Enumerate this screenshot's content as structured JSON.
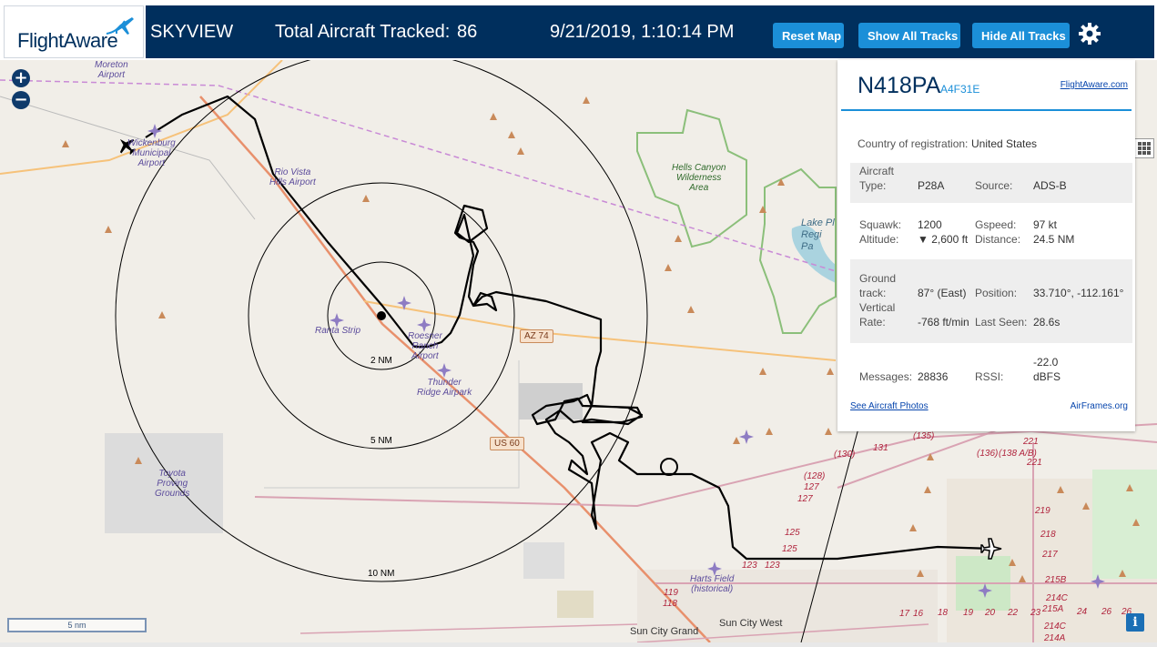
{
  "header": {
    "logo_text": "FlightAware",
    "app_title": "SKYVIEW",
    "total_label": "Total Aircraft Tracked:",
    "total_count": "86",
    "datetime": "9/21/2019, 1:10:14 PM",
    "reset_map_label": "Reset Map",
    "show_all_tracks_label": "Show All Tracks",
    "hide_all_tracks_label": "Hide All Tracks",
    "settings_icon": "gear-icon",
    "brand_color": "#002f5d",
    "button_color": "#1b8fd8"
  },
  "map": {
    "zoom_in": "+",
    "zoom_out": "−",
    "scale_label": "5 nm",
    "info_label": "i",
    "range_rings": [
      "2 NM",
      "5 NM",
      "10 NM"
    ],
    "airports": {
      "moreton": "Moreton\nAirport",
      "wickenburg": "Wickenburg\nMunicipal\nAirport",
      "rio_vista": "Rio Vista\nHills Airport",
      "ranta": "Ranta Strip",
      "roesner": "Roesner\nRanch\nAirport",
      "thunder": "Thunder\nRidge Airpark",
      "harts": "Harts Field\n(historical)",
      "tovota": "Toyota\nProving\nGrounds"
    },
    "wilderness": "Hells Canyon\nWilderness\nArea",
    "lake": "Lake Pl\nRegi\nPa",
    "places": {
      "sun_city_grand": "Sun City Grand",
      "sun_city_west": "Sun City West"
    },
    "shields": {
      "az74": "AZ 74",
      "us60": "US 60"
    },
    "road_numbers": [
      "(135)",
      "(130)",
      "131",
      "(136)",
      "(138 A/B)",
      "221",
      "221",
      "(128)",
      "127",
      "127",
      "125",
      "125",
      "123",
      "123",
      "219",
      "218",
      "217",
      "215B",
      "214C",
      "215A",
      "214C",
      "214A",
      "119",
      "118",
      "17",
      "16",
      "18",
      "19",
      "20",
      "22",
      "23",
      "24",
      "26",
      "26"
    ]
  },
  "aircraft": {
    "callsign": "N418PA",
    "hex": "A4F31E",
    "fa_link": "FlightAware.com",
    "country_label": "Country of registration:",
    "country": "United States",
    "type_label": "Aircraft\nType:",
    "type": "P28A",
    "source_label": "Source:",
    "source": "ADS-B",
    "squawk_label": "Squawk:",
    "squawk": "1200",
    "gspeed_label": "Gspeed:",
    "gspeed": "97 kt",
    "altitude_label": "Altitude:",
    "altitude": "▼ 2,600 ft",
    "distance_label": "Distance:",
    "distance": "24.5 NM",
    "ground_track_label": "Ground\ntrack:",
    "ground_track": "87° (East)",
    "position_label": "Position:",
    "position": "33.710°, -112.161°",
    "vertical_rate_label": "Vertical\nRate:",
    "vertical_rate": "-768 ft/min",
    "last_seen_label": "Last Seen:",
    "last_seen": "28.6s",
    "messages_label": "Messages:",
    "messages": "28836",
    "rssi_label": "RSSI:",
    "rssi": "-22.0\ndBFS",
    "photos_link": "See Aircraft Photos",
    "airframes_link": "AirFrames.org"
  }
}
